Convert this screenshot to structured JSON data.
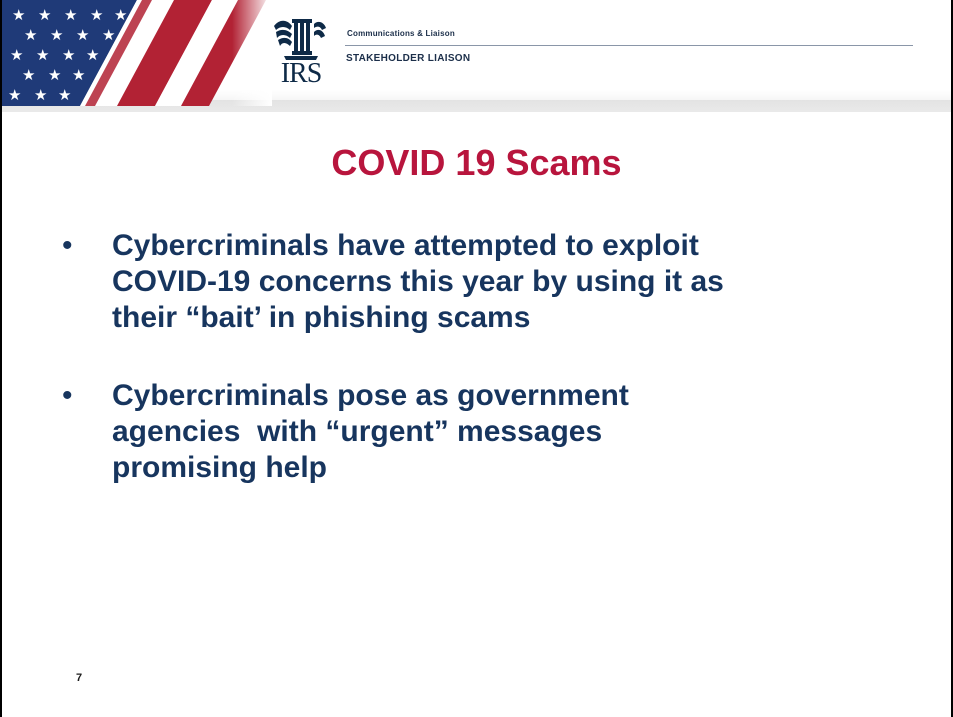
{
  "header": {
    "department": "Communications & Liaison",
    "division": "STAKEHOLDER LIAISON",
    "logo_text": "IRS",
    "flag_icon": "american-flag-icon",
    "eagle_icon": "irs-eagle-icon"
  },
  "slide": {
    "title": "COVID 19 Scams",
    "bullets": [
      {
        "marker": "•",
        "lines": [
          "Cybercriminals have attempted to exploit",
          "COVID-19 concerns this year by using it as",
          "their “bait’ in phishing scams"
        ]
      },
      {
        "marker": "•",
        "lines": [
          "Cybercriminals pose as government",
          "agencies  with “urgent” messages",
          "promising help"
        ]
      }
    ],
    "page_number": "7"
  },
  "colors": {
    "title": "#b8153d",
    "body_text": "#17355e",
    "flag_red": "#b22234",
    "flag_blue": "#1f3a78"
  }
}
